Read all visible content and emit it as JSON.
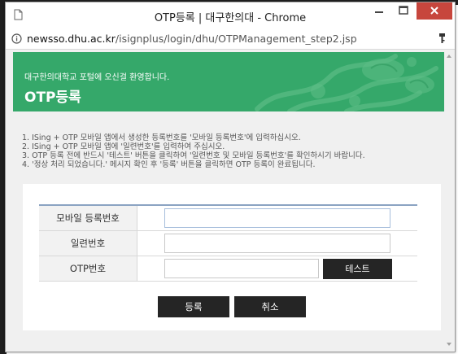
{
  "window": {
    "title": "OTP등록 | 대구한의대 - Chrome"
  },
  "address": {
    "host": "newsso.dhu.ac.kr",
    "path": "/isignplus/login/dhu/OTPManagement_step2.jsp"
  },
  "header": {
    "welcome": "대구한의대학교 포털에 오신걸 환영합니다.",
    "title": "OTP등록",
    "color": "#35a86a"
  },
  "instructions": [
    "1. ISing + OTP 모바일 앱에서 생성한 등록번호를 '모바일 등록번호'에 입력하십시오.",
    "2. ISing + OTP 모바일 앱에 '일련번호'를 입력하여 주십시오.",
    "3. OTP 등록 전에 반드시 '테스트' 버튼을 클릭하여 '일련번호 및 모바일 등록번호'를 확인하시기 바랍니다.",
    "4. '정상 처리 되었습니다.' 메시지 확인 후 '등록' 버튼을 클릭하면 OTP 등록이 완료됩니다."
  ],
  "form": {
    "mobile_reg_label": "모바일 등록번호",
    "mobile_reg_value": "",
    "serial_label": "일련번호",
    "serial_value": "",
    "otp_label": "OTP번호",
    "otp_value": "",
    "test_button": "테스트"
  },
  "actions": {
    "register": "등록",
    "cancel": "취소"
  }
}
